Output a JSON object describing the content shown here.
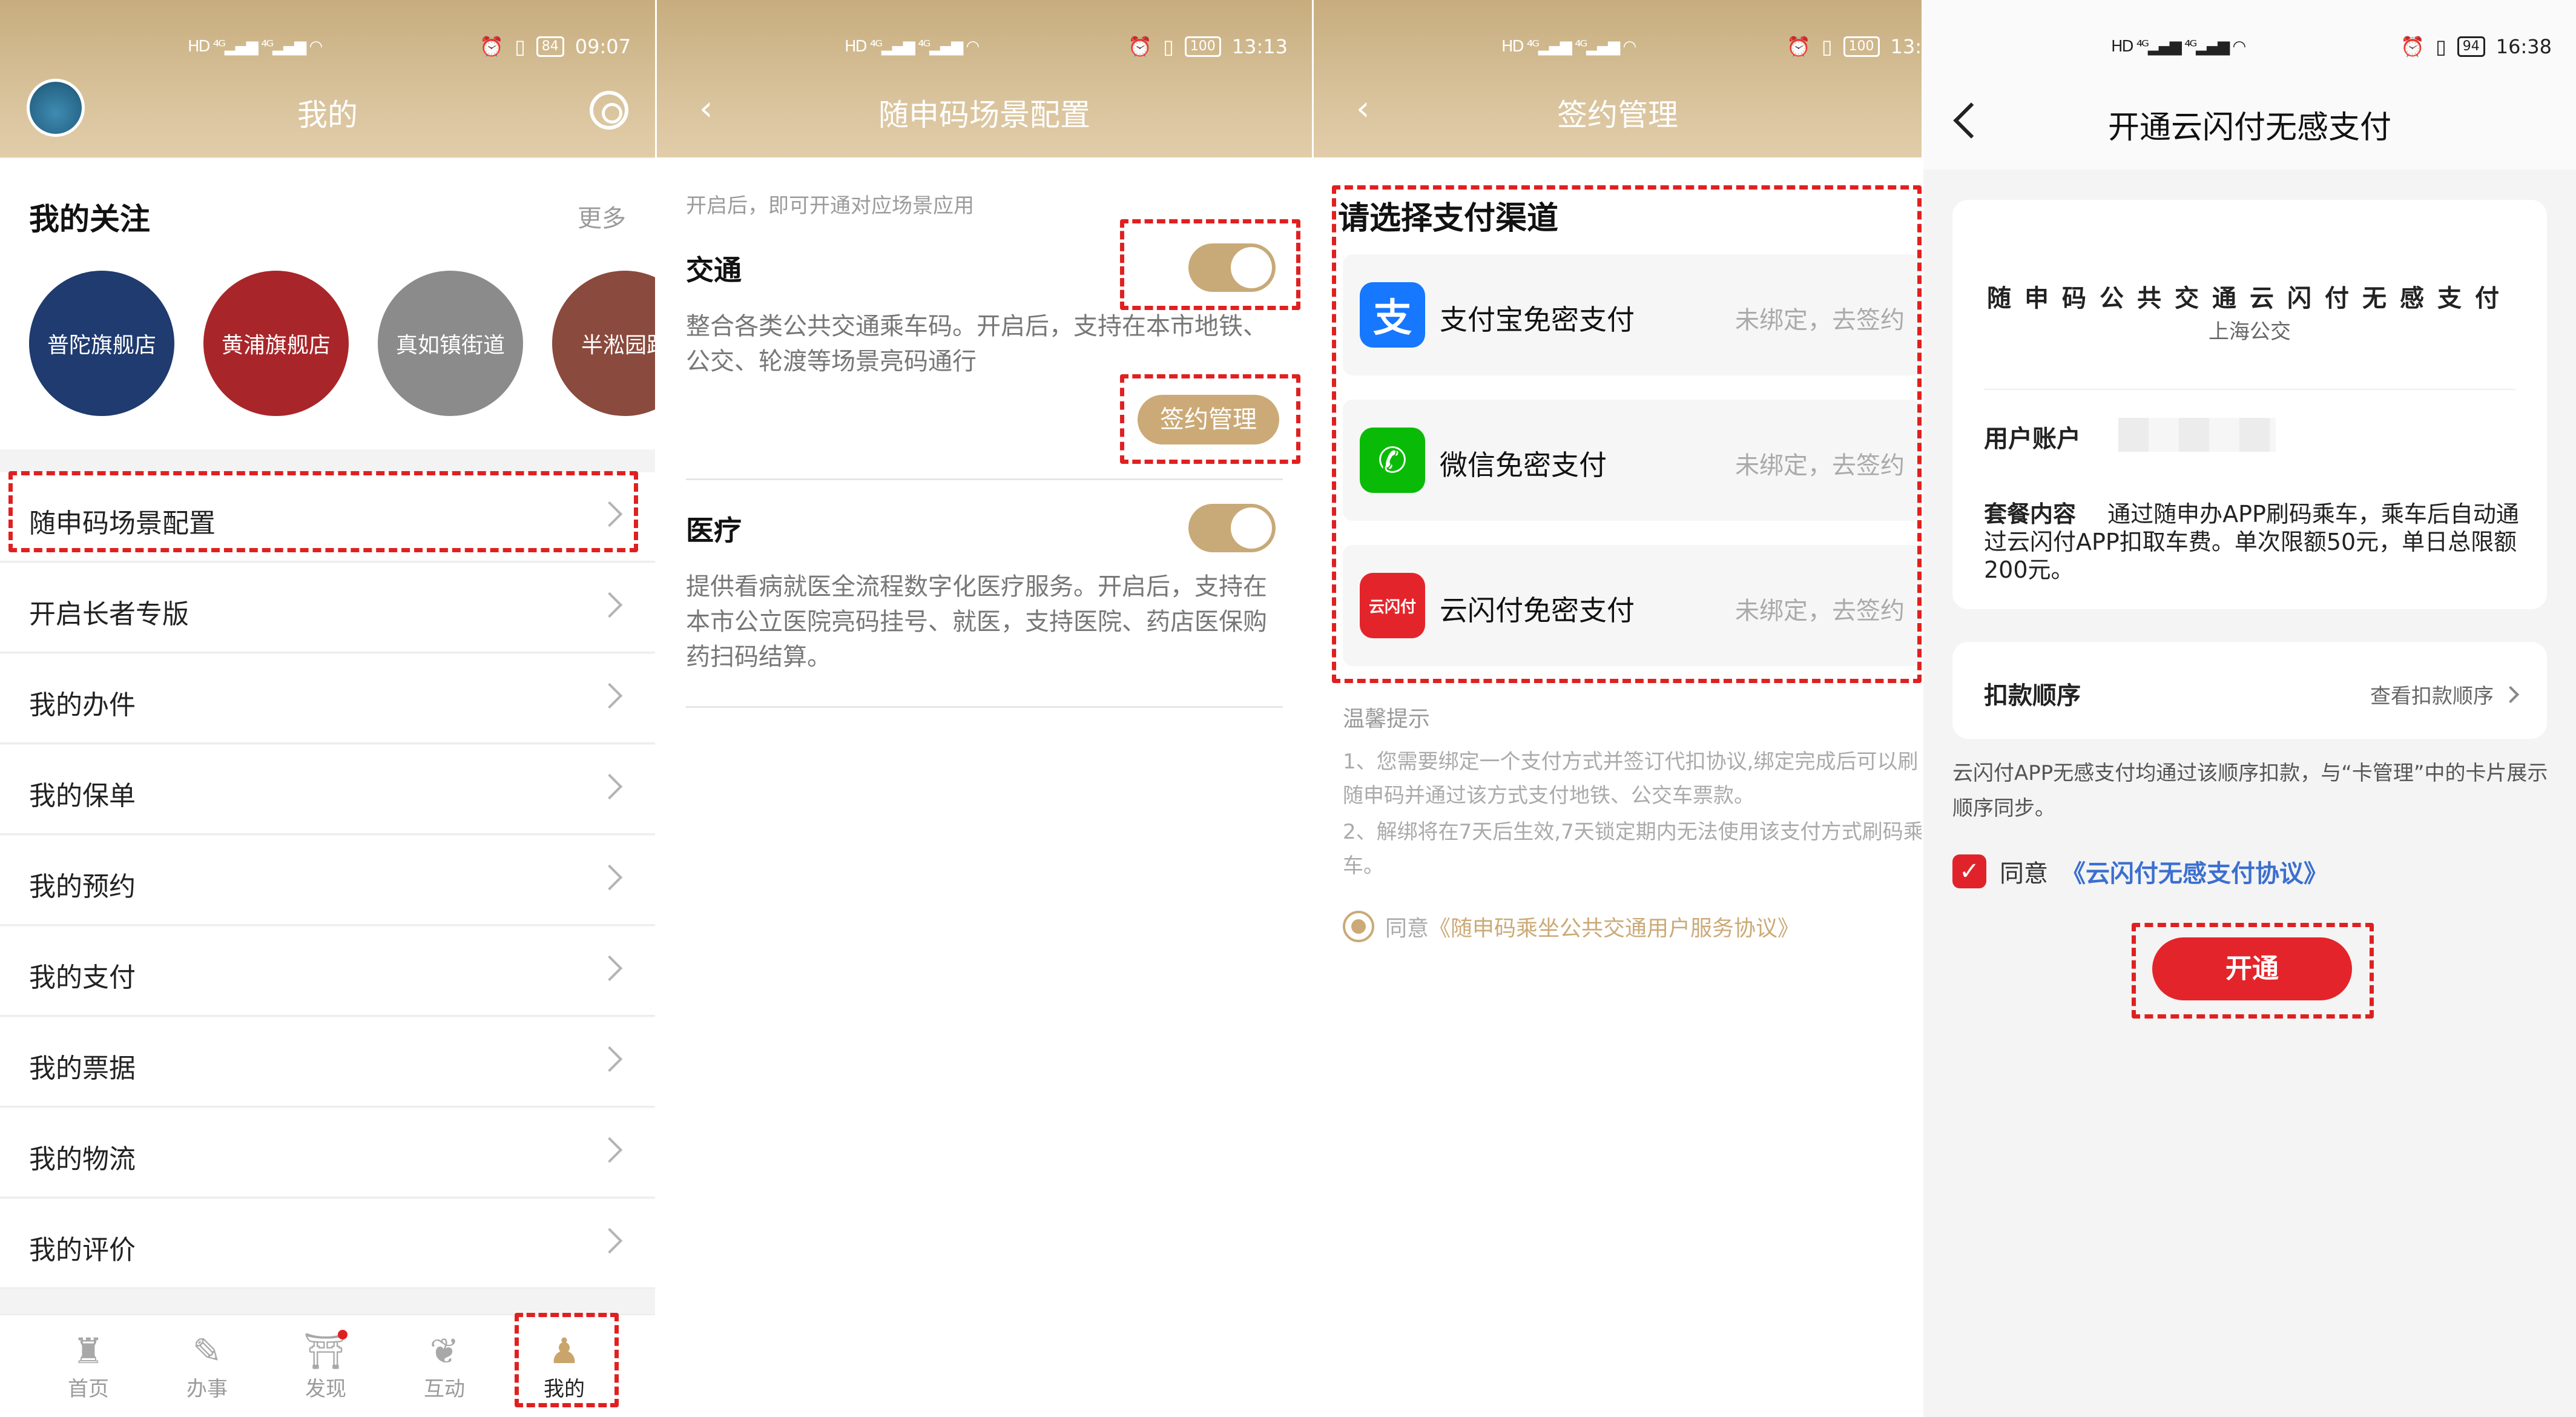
{
  "colors": {
    "gold": "#c8a978",
    "red_dash": "#e02020",
    "unionpay_red": "#e3252b",
    "alipay_blue": "#1677ff",
    "wechat_green": "#09bb07"
  },
  "panel1": {
    "status_time": "09:07",
    "battery": "84",
    "header_title": "我的",
    "follow": {
      "title": "我的关注",
      "more": "更多",
      "items": [
        {
          "label": "普陀旗舰店",
          "color": "#1f3b6f"
        },
        {
          "label": "黄浦旗舰店",
          "color": "#a8262a"
        },
        {
          "label": "真如镇街道",
          "color": "#8b8b8b"
        },
        {
          "label": "半淞园路",
          "color": "#8a4a3d"
        }
      ]
    },
    "menu": [
      "随申码场景配置",
      "开启长者专版",
      "我的办件",
      "我的保单",
      "我的预约",
      "我的支付",
      "我的票据",
      "我的物流",
      "我的评价"
    ],
    "tabs": [
      {
        "label": "首页",
        "icon": "home-tower-icon"
      },
      {
        "label": "办事",
        "icon": "pen-icon"
      },
      {
        "label": "发现",
        "icon": "discover-icon"
      },
      {
        "label": "互动",
        "icon": "lotus-icon"
      },
      {
        "label": "我的",
        "icon": "person-icon"
      }
    ]
  },
  "panel2": {
    "status_time": "13:13",
    "battery": "100",
    "header_title": "随申码场景配置",
    "hint": "开启后，即可开通对应场景应用",
    "traffic": {
      "title": "交通",
      "desc": "整合各类公共交通乘车码。开启后，支持在本市地铁、公交、轮渡等场景亮码通行",
      "enabled": true,
      "button": "签约管理"
    },
    "medical": {
      "title": "医疗",
      "desc": "提供看病就医全流程数字化医疗服务。开启后，支持在本市公立医院亮码挂号、就医，支持医院、药店医保购药扫码结算。",
      "enabled": true
    }
  },
  "panel3": {
    "status_time": "13:",
    "battery": "100",
    "header_title": "签约管理",
    "select_title": "请选择支付渠道",
    "channels": [
      {
        "name": "支付宝免密支付",
        "status": "未绑定，去签约",
        "icon": "alipay-icon",
        "glyph": "支"
      },
      {
        "name": "微信免密支付",
        "status": "未绑定，去签约",
        "icon": "wechat-icon",
        "glyph": "✆"
      },
      {
        "name": "云闪付免密支付",
        "status": "未绑定，去签约",
        "icon": "unionpay-icon",
        "glyph": "云闪付"
      }
    ],
    "tips_title": "温馨提示",
    "tips": [
      "1、您需要绑定一个支付方式并签订代扣协议,绑定完成后可以刷随申码并通过该方式支付地铁、公交车票款。",
      "2、解绑将在7天后生效,7天锁定期内无法使用该支付方式刷码乘车。"
    ],
    "agree_prefix": "同意",
    "agree_link": "《随申码乘坐公共交通用户服务协议》"
  },
  "panel4": {
    "status_time": "16:38",
    "battery": "94",
    "header_title": "开通云闪付无感支付",
    "card_title": "随申码公共交通云闪付无感支付",
    "card_sub": "上海公交",
    "account_label": "用户账户",
    "package_label": "套餐内容",
    "package_text": "通过随申办APP刷码乘车，乘车后自动通过云闪付APP扣取车费。单次限额50元，单日总限额200元。",
    "order_label": "扣款顺序",
    "order_link": "查看扣款顺序",
    "note": "云闪付APP无感支付均通过该顺序扣款，与“卡管理”中的卡片展示顺序同步。",
    "agree_prefix": "同意",
    "agree_link": "《云闪付无感支付协议》",
    "open_button": "开通"
  }
}
